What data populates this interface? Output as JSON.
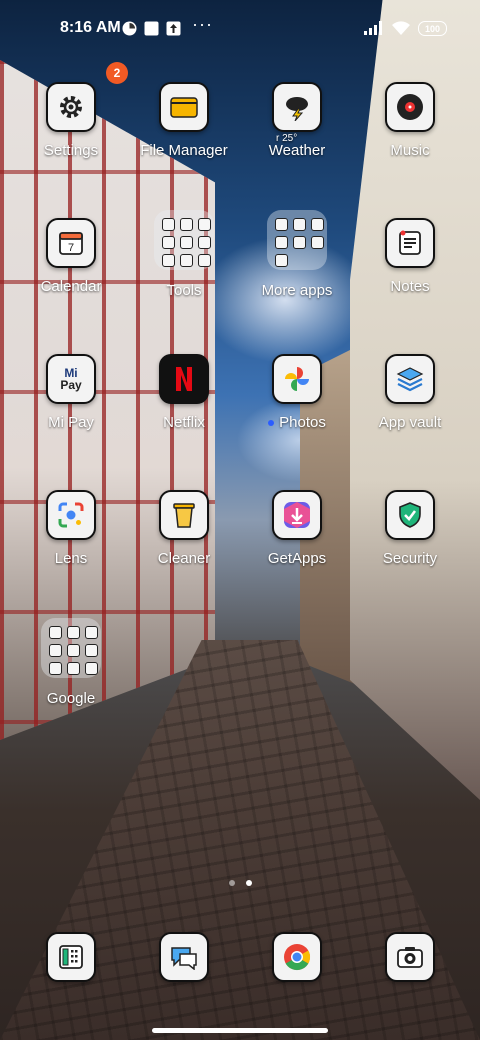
{
  "status_bar": {
    "time": "8:16 AM",
    "battery": "100"
  },
  "apps": [
    {
      "name": "settings",
      "label": "Settings",
      "icon": "gear-icon",
      "badge": "2"
    },
    {
      "name": "file-manager",
      "label": "File Manager",
      "icon": "folder-icon"
    },
    {
      "name": "weather",
      "label": "Weather",
      "icon": "weather-storm-icon",
      "extra": "r 25°"
    },
    {
      "name": "music",
      "label": "Music",
      "icon": "music-disc-icon"
    },
    {
      "name": "calendar",
      "label": "Calendar",
      "icon": "calendar-icon",
      "extra": "7"
    },
    {
      "name": "tools-folder",
      "label": "Tools",
      "icon": "folder-grid"
    },
    {
      "name": "more-apps-folder",
      "label": "More apps",
      "icon": "folder-grid"
    },
    {
      "name": "notes",
      "label": "Notes",
      "icon": "notes-icon"
    },
    {
      "name": "mi-pay",
      "label": "Mi Pay",
      "icon": "mi-pay-icon"
    },
    {
      "name": "netflix",
      "label": "Netflix",
      "icon": "netflix-icon"
    },
    {
      "name": "photos",
      "label": "Photos",
      "icon": "photos-pinwheel-icon"
    },
    {
      "name": "app-vault",
      "label": "App vault",
      "icon": "app-vault-icon"
    },
    {
      "name": "lens",
      "label": "Lens",
      "icon": "lens-icon"
    },
    {
      "name": "cleaner",
      "label": "Cleaner",
      "icon": "cleaner-icon"
    },
    {
      "name": "getapps",
      "label": "GetApps",
      "icon": "getapps-icon"
    },
    {
      "name": "security",
      "label": "Security",
      "icon": "shield-icon"
    },
    {
      "name": "google-folder",
      "label": "Google",
      "icon": "folder-grid"
    }
  ],
  "dock": [
    {
      "name": "phone-dock",
      "icon": "dialer-icon"
    },
    {
      "name": "messages-dock",
      "icon": "messages-icon"
    },
    {
      "name": "chrome-dock",
      "icon": "chrome-icon"
    },
    {
      "name": "camera-dock",
      "icon": "camera-icon"
    }
  ],
  "mipay_text": {
    "mi": "Mi",
    "pay": "Pay"
  },
  "colors": {
    "badge": "#f15a24",
    "netflix": "#e50914",
    "security": "#1fb57a",
    "file_manager": "#f7b500"
  }
}
